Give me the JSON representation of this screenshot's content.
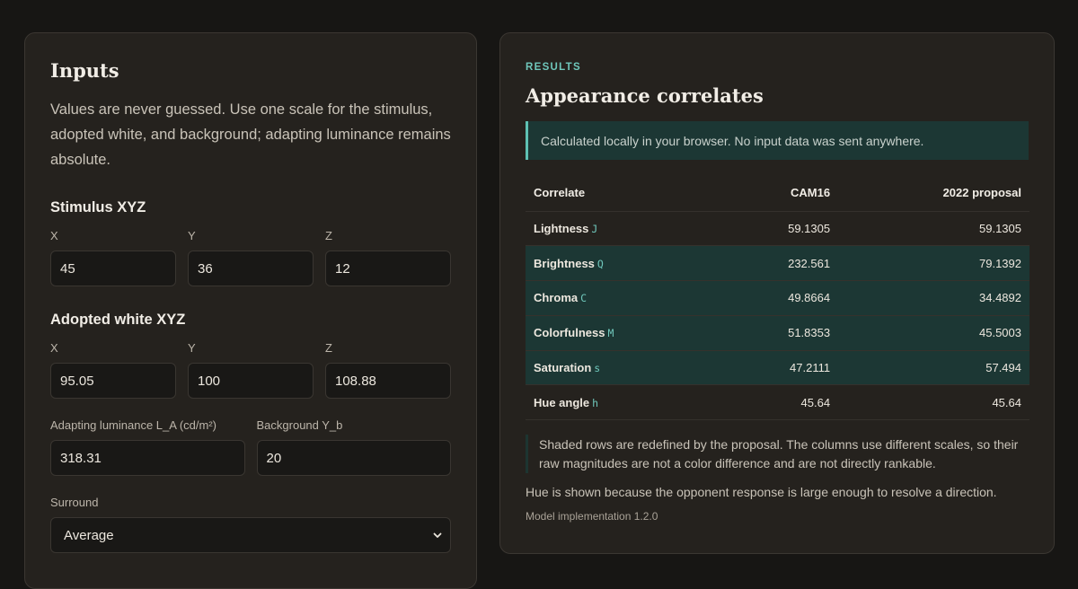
{
  "inputs": {
    "title": "Inputs",
    "intro": "Values are never guessed. Use one scale for the stimulus, adopted white, and background; adapting luminance remains absolute.",
    "stimulus": {
      "heading": "Stimulus XYZ",
      "x_label": "X",
      "y_label": "Y",
      "z_label": "Z",
      "x": "45",
      "y": "36",
      "z": "12"
    },
    "white": {
      "heading": "Adopted white XYZ",
      "x_label": "X",
      "y_label": "Y",
      "z_label": "Z",
      "x": "95.05",
      "y": "100",
      "z": "108.88"
    },
    "adapting_label": "Adapting luminance L_A (cd/m²)",
    "adapting_value": "318.31",
    "background_label": "Background Y_b",
    "background_value": "20",
    "surround_label": "Surround",
    "surround_value": "Average"
  },
  "results": {
    "eyebrow": "RESULTS",
    "title": "Appearance correlates",
    "notice": "Calculated locally in your browser. No input data was sent anywhere.",
    "columns": [
      "Correlate",
      "CAM16",
      "2022 proposal"
    ],
    "rows": [
      {
        "name": "Lightness",
        "symbol": "J",
        "cam16": "59.1305",
        "proposal": "59.1305"
      },
      {
        "name": "Brightness",
        "symbol": "Q",
        "cam16": "232.561",
        "proposal": "79.1392"
      },
      {
        "name": "Chroma",
        "symbol": "C",
        "cam16": "49.8664",
        "proposal": "34.4892"
      },
      {
        "name": "Colorfulness",
        "symbol": "M",
        "cam16": "51.8353",
        "proposal": "45.5003"
      },
      {
        "name": "Saturation",
        "symbol": "s",
        "cam16": "47.2111",
        "proposal": "57.494"
      },
      {
        "name": "Hue angle",
        "symbol": "h",
        "cam16": "45.64",
        "proposal": "45.64"
      }
    ],
    "note": "Shaded rows are redefined by the proposal. The columns use different scales, so their raw magnitudes are not a color difference and are not directly rankable.",
    "hue_note": "Hue is shown because the opponent response is large enough to resolve a direction.",
    "version": "Model implementation 1.2.0"
  },
  "colors": {
    "background": "#171614",
    "card": "#25221e",
    "accent": "#6fc7bb",
    "shaded_row": "#1c3734"
  },
  "icons": {
    "surround_dropdown": "chevron-down-icon"
  }
}
